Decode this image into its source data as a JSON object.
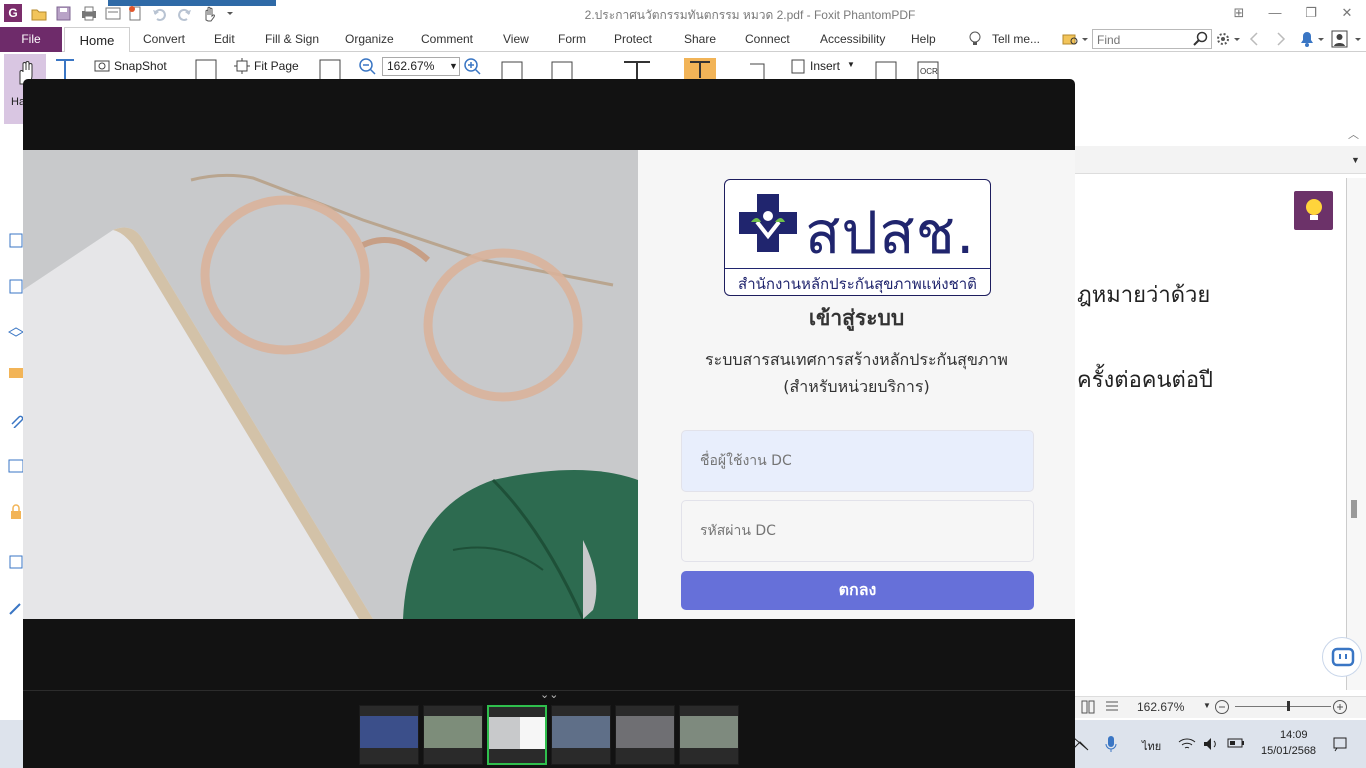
{
  "window": {
    "title": "2.ประกาศนวัตกรรมทันตกรรม หมวด 2.pdf - Foxit PhantomPDF",
    "app_logo": "G"
  },
  "ribbon": {
    "file_label": "File",
    "tabs": [
      "Home",
      "Convert",
      "Edit",
      "Fill & Sign",
      "Organize",
      "Comment",
      "View",
      "Form",
      "Protect",
      "Share",
      "Connect",
      "Accessibility",
      "Help"
    ],
    "tell_me": "Tell me...",
    "find_placeholder": "Find"
  },
  "toolbar": {
    "hand_label": "Ha",
    "snapshot_label": "SnapShot",
    "fit_page_label": "Fit Page",
    "zoom_value": "162.67%",
    "insert_label": "Insert"
  },
  "document": {
    "line1": "ฎหมายว่าด้วย",
    "line2": "ครั้งต่อคนต่อปี"
  },
  "statusbar": {
    "zoom": "162.67%"
  },
  "taskbar": {
    "language": "ไทย",
    "time": "14:09",
    "date": "15/01/2568"
  },
  "login": {
    "logo_text": "สปสช.",
    "logo_subtext": "สำนักงานหลักประกันสุขภาพแห่งชาติ",
    "title": "เข้าสู่ระบบ",
    "subtitle_line1": "ระบบสารสนเทศการสร้างหลักประกันสุขภาพ",
    "subtitle_line2": "(สำหรับหน่วยบริการ)",
    "username_placeholder": "ชื่อผู้ใช้งาน DC",
    "password_placeholder": "รหัสผ่าน DC",
    "submit_label": "ตกลง"
  },
  "colors": {
    "foxit_purple": "#6e2b6a",
    "login_button": "#6670d9",
    "logo_navy": "#20256e",
    "active_thumb": "#2fbf4d"
  },
  "filmstrip": {
    "count": 6,
    "active_index": 2
  }
}
